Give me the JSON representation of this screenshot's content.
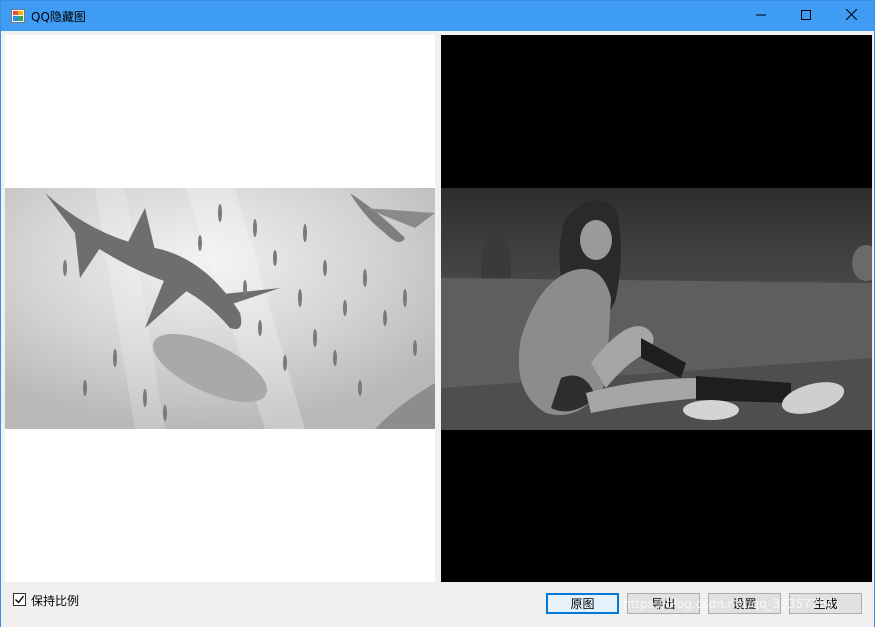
{
  "window": {
    "title": "QQ隐藏图",
    "app_icon": "app-icon",
    "controls": [
      "minimize-icon",
      "maximize-icon",
      "close-icon"
    ]
  },
  "left_panel": {
    "image": "grayscale-underwater-sharks-image",
    "background": "#ffffff"
  },
  "right_panel": {
    "image": "grayscale-portrait-girl-sitting-image",
    "background": "#000000"
  },
  "bottom_bar": {
    "keep_ratio": {
      "label": "保持比例",
      "checked": true
    },
    "buttons": {
      "original": "原图",
      "export": "导出",
      "settings": "设置",
      "generate": "生成"
    }
  },
  "watermark": "https://blog.csdn.net/qq_39357794",
  "colors": {
    "titlebar": "#3f9cf4",
    "accent": "#0078d7",
    "button_face": "#e1e1e1"
  }
}
